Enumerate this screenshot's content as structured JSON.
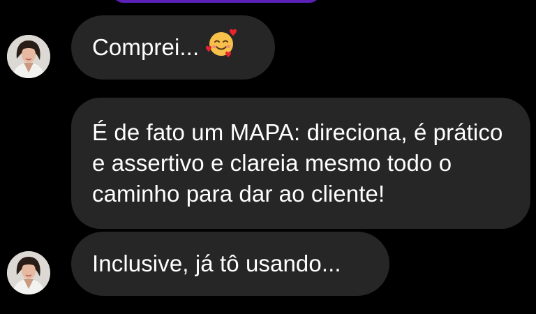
{
  "messages": [
    {
      "text": "Comprei...",
      "emoji": "smiling-face-with-hearts-icon"
    },
    {
      "text": "É de fato um MAPA: direciona, é prático e assertivo e clareia mesmo todo o caminho para dar ao cliente!"
    },
    {
      "text": "Inclusive, já tô usando..."
    }
  ],
  "colors": {
    "background": "#000000",
    "bubble": "#262626",
    "text": "#ffffff",
    "accent": "#5b21b6"
  }
}
